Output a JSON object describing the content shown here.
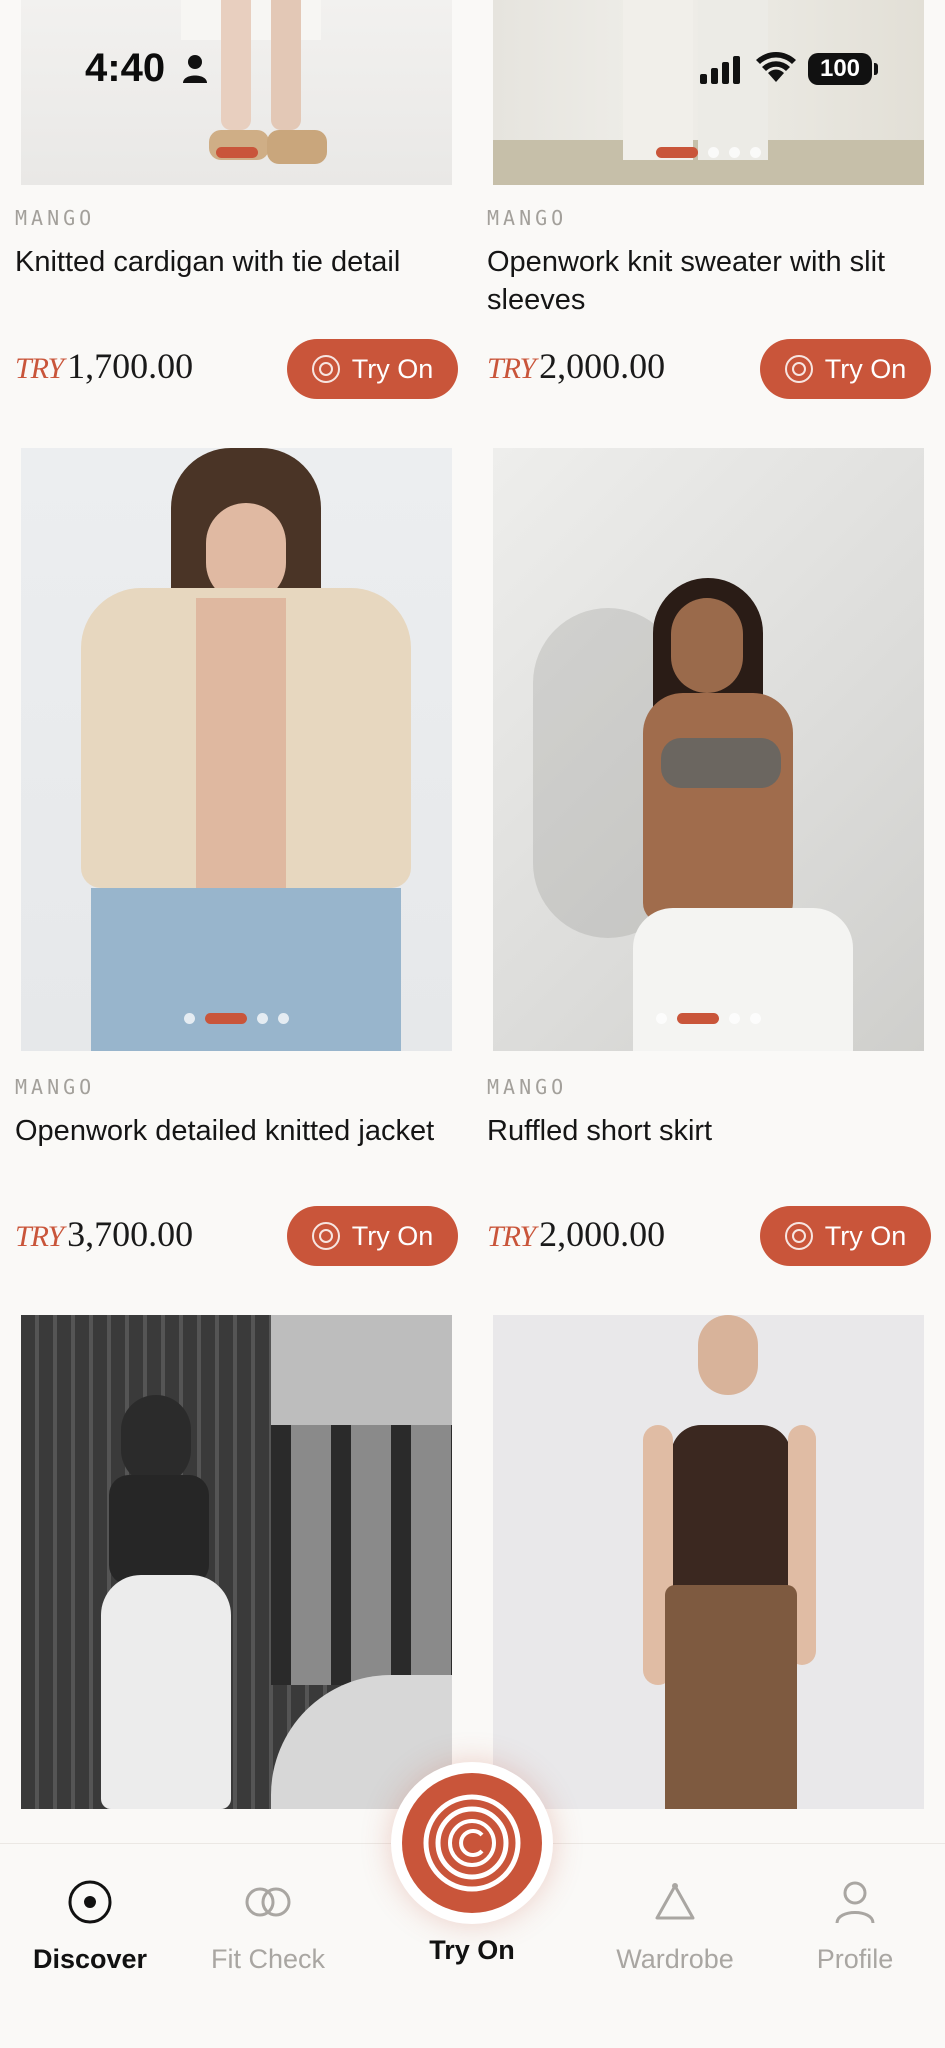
{
  "status_bar": {
    "time": "4:40",
    "battery": "100"
  },
  "products": [
    {
      "brand": "MANGO",
      "title": "Knitted cardigan with tie detail",
      "currency": "TRY",
      "price": "1,700.00",
      "button": "Try On",
      "image_count": 1,
      "active_image": 0
    },
    {
      "brand": "MANGO",
      "title": "Openwork knit sweater with slit sleeves",
      "currency": "TRY",
      "price": "2,000.00",
      "button": "Try On",
      "image_count": 4,
      "active_image": 0
    },
    {
      "brand": "MANGO",
      "title": "Openwork detailed knitted jacket",
      "currency": "TRY",
      "price": "3,700.00",
      "button": "Try On",
      "image_count": 4,
      "active_image": 1
    },
    {
      "brand": "MANGO",
      "title": "Ruffled short skirt",
      "currency": "TRY",
      "price": "2,000.00",
      "button": "Try On",
      "image_count": 4,
      "active_image": 1
    },
    {
      "image_only": true
    },
    {
      "image_only": true
    }
  ],
  "nav": {
    "items": [
      {
        "label": "Discover",
        "icon": "discover-icon",
        "active": true
      },
      {
        "label": "Fit Check",
        "icon": "fit-check-icon",
        "active": false
      },
      {
        "label": "Try On",
        "icon": "try-on-icon",
        "active": true
      },
      {
        "label": "Wardrobe",
        "icon": "hanger-icon",
        "active": false
      },
      {
        "label": "Profile",
        "icon": "profile-icon",
        "active": false
      }
    ]
  },
  "colors": {
    "accent": "#c9553a",
    "background": "#faf9f7",
    "muted_text": "#a9a6a2"
  }
}
